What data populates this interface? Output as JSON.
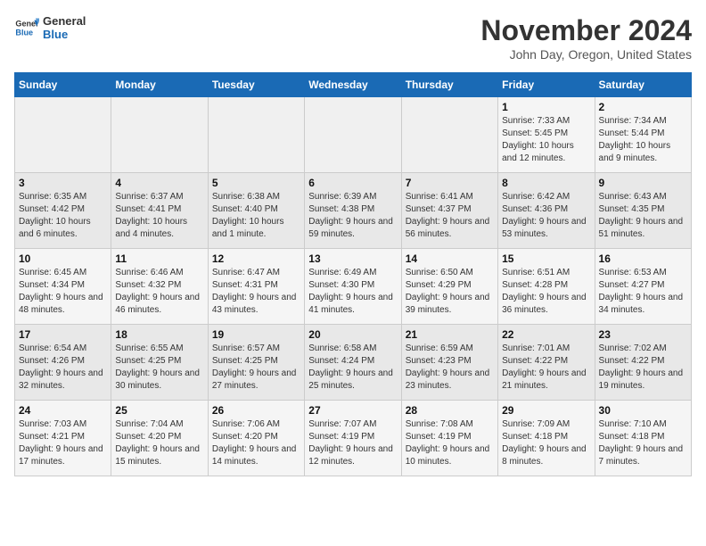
{
  "header": {
    "logo_line1": "General",
    "logo_line2": "Blue",
    "month": "November 2024",
    "location": "John Day, Oregon, United States"
  },
  "weekdays": [
    "Sunday",
    "Monday",
    "Tuesday",
    "Wednesday",
    "Thursday",
    "Friday",
    "Saturday"
  ],
  "weeks": [
    [
      {
        "day": "",
        "info": ""
      },
      {
        "day": "",
        "info": ""
      },
      {
        "day": "",
        "info": ""
      },
      {
        "day": "",
        "info": ""
      },
      {
        "day": "",
        "info": ""
      },
      {
        "day": "1",
        "info": "Sunrise: 7:33 AM\nSunset: 5:45 PM\nDaylight: 10 hours and 12 minutes."
      },
      {
        "day": "2",
        "info": "Sunrise: 7:34 AM\nSunset: 5:44 PM\nDaylight: 10 hours and 9 minutes."
      }
    ],
    [
      {
        "day": "3",
        "info": "Sunrise: 6:35 AM\nSunset: 4:42 PM\nDaylight: 10 hours and 6 minutes."
      },
      {
        "day": "4",
        "info": "Sunrise: 6:37 AM\nSunset: 4:41 PM\nDaylight: 10 hours and 4 minutes."
      },
      {
        "day": "5",
        "info": "Sunrise: 6:38 AM\nSunset: 4:40 PM\nDaylight: 10 hours and 1 minute."
      },
      {
        "day": "6",
        "info": "Sunrise: 6:39 AM\nSunset: 4:38 PM\nDaylight: 9 hours and 59 minutes."
      },
      {
        "day": "7",
        "info": "Sunrise: 6:41 AM\nSunset: 4:37 PM\nDaylight: 9 hours and 56 minutes."
      },
      {
        "day": "8",
        "info": "Sunrise: 6:42 AM\nSunset: 4:36 PM\nDaylight: 9 hours and 53 minutes."
      },
      {
        "day": "9",
        "info": "Sunrise: 6:43 AM\nSunset: 4:35 PM\nDaylight: 9 hours and 51 minutes."
      }
    ],
    [
      {
        "day": "10",
        "info": "Sunrise: 6:45 AM\nSunset: 4:34 PM\nDaylight: 9 hours and 48 minutes."
      },
      {
        "day": "11",
        "info": "Sunrise: 6:46 AM\nSunset: 4:32 PM\nDaylight: 9 hours and 46 minutes."
      },
      {
        "day": "12",
        "info": "Sunrise: 6:47 AM\nSunset: 4:31 PM\nDaylight: 9 hours and 43 minutes."
      },
      {
        "day": "13",
        "info": "Sunrise: 6:49 AM\nSunset: 4:30 PM\nDaylight: 9 hours and 41 minutes."
      },
      {
        "day": "14",
        "info": "Sunrise: 6:50 AM\nSunset: 4:29 PM\nDaylight: 9 hours and 39 minutes."
      },
      {
        "day": "15",
        "info": "Sunrise: 6:51 AM\nSunset: 4:28 PM\nDaylight: 9 hours and 36 minutes."
      },
      {
        "day": "16",
        "info": "Sunrise: 6:53 AM\nSunset: 4:27 PM\nDaylight: 9 hours and 34 minutes."
      }
    ],
    [
      {
        "day": "17",
        "info": "Sunrise: 6:54 AM\nSunset: 4:26 PM\nDaylight: 9 hours and 32 minutes."
      },
      {
        "day": "18",
        "info": "Sunrise: 6:55 AM\nSunset: 4:25 PM\nDaylight: 9 hours and 30 minutes."
      },
      {
        "day": "19",
        "info": "Sunrise: 6:57 AM\nSunset: 4:25 PM\nDaylight: 9 hours and 27 minutes."
      },
      {
        "day": "20",
        "info": "Sunrise: 6:58 AM\nSunset: 4:24 PM\nDaylight: 9 hours and 25 minutes."
      },
      {
        "day": "21",
        "info": "Sunrise: 6:59 AM\nSunset: 4:23 PM\nDaylight: 9 hours and 23 minutes."
      },
      {
        "day": "22",
        "info": "Sunrise: 7:01 AM\nSunset: 4:22 PM\nDaylight: 9 hours and 21 minutes."
      },
      {
        "day": "23",
        "info": "Sunrise: 7:02 AM\nSunset: 4:22 PM\nDaylight: 9 hours and 19 minutes."
      }
    ],
    [
      {
        "day": "24",
        "info": "Sunrise: 7:03 AM\nSunset: 4:21 PM\nDaylight: 9 hours and 17 minutes."
      },
      {
        "day": "25",
        "info": "Sunrise: 7:04 AM\nSunset: 4:20 PM\nDaylight: 9 hours and 15 minutes."
      },
      {
        "day": "26",
        "info": "Sunrise: 7:06 AM\nSunset: 4:20 PM\nDaylight: 9 hours and 14 minutes."
      },
      {
        "day": "27",
        "info": "Sunrise: 7:07 AM\nSunset: 4:19 PM\nDaylight: 9 hours and 12 minutes."
      },
      {
        "day": "28",
        "info": "Sunrise: 7:08 AM\nSunset: 4:19 PM\nDaylight: 9 hours and 10 minutes."
      },
      {
        "day": "29",
        "info": "Sunrise: 7:09 AM\nSunset: 4:18 PM\nDaylight: 9 hours and 8 minutes."
      },
      {
        "day": "30",
        "info": "Sunrise: 7:10 AM\nSunset: 4:18 PM\nDaylight: 9 hours and 7 minutes."
      }
    ]
  ]
}
